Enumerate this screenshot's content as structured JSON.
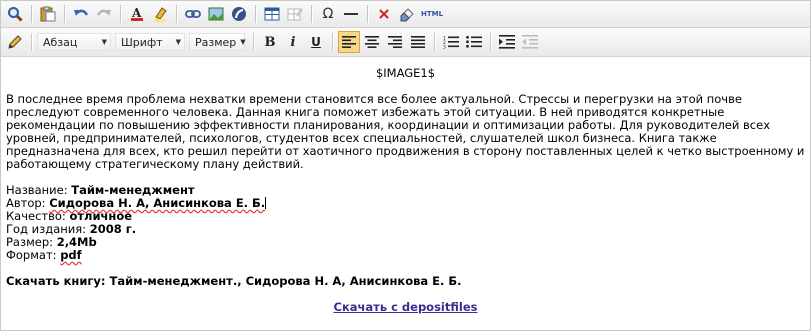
{
  "toolbar1": {
    "buttons": [
      "find",
      "paste",
      "undo",
      "redo",
      "text-color",
      "highlight",
      "link",
      "image",
      "flash",
      "table",
      "edit-table",
      "special-char",
      "horizontal-line",
      "remove",
      "clean",
      "html-source"
    ],
    "omega": "Ω",
    "html_label": "HTML"
  },
  "toolbar2": {
    "paragraph": "Абзац",
    "font": "Шрифт",
    "size": "Размер",
    "bold": "B",
    "italic": "i",
    "underline": "U"
  },
  "content": {
    "image_placeholder": "$IMAGE1$",
    "description": "В последнее время проблема нехватки времени становится все более актуальной. Стрессы и перегрузки на этой почве преследуют современного человека. Данная книга поможет избежать этой ситуации. В ней приводятся конкретные рекомендации по повышению эффективности планирования, координации и оптимизации работы. Для руководителей всех уровней, предпринимателей, психологов, студентов всех специальностей, слушателей школ бизнеса. Книга также предназначена для всех, кто решил перейти от хаотичного продвижения в сторону поставленных целей к четко выстроенному и работающему стратегическому плану действий.",
    "fields": {
      "title_label": "Название: ",
      "title_value": "Тайм-менеджмент",
      "author_label": "Автор: ",
      "author_value": "Сидорова Н. А, Анисинкова Е. Б.",
      "quality_label": "Качество: ",
      "quality_value": "отличное",
      "year_label": "Год издания: ",
      "year_value": "2008 г.",
      "size_label": "Размер: ",
      "size_value": "2,4Mb",
      "format_label": "Формат: ",
      "format_value": "pdf"
    },
    "download_text": "Скачать книгу: Тайм-менеджмент., Сидорова Н. А, Анисинкова Е. Б.",
    "download_link": "Скачать с depositfiles"
  }
}
